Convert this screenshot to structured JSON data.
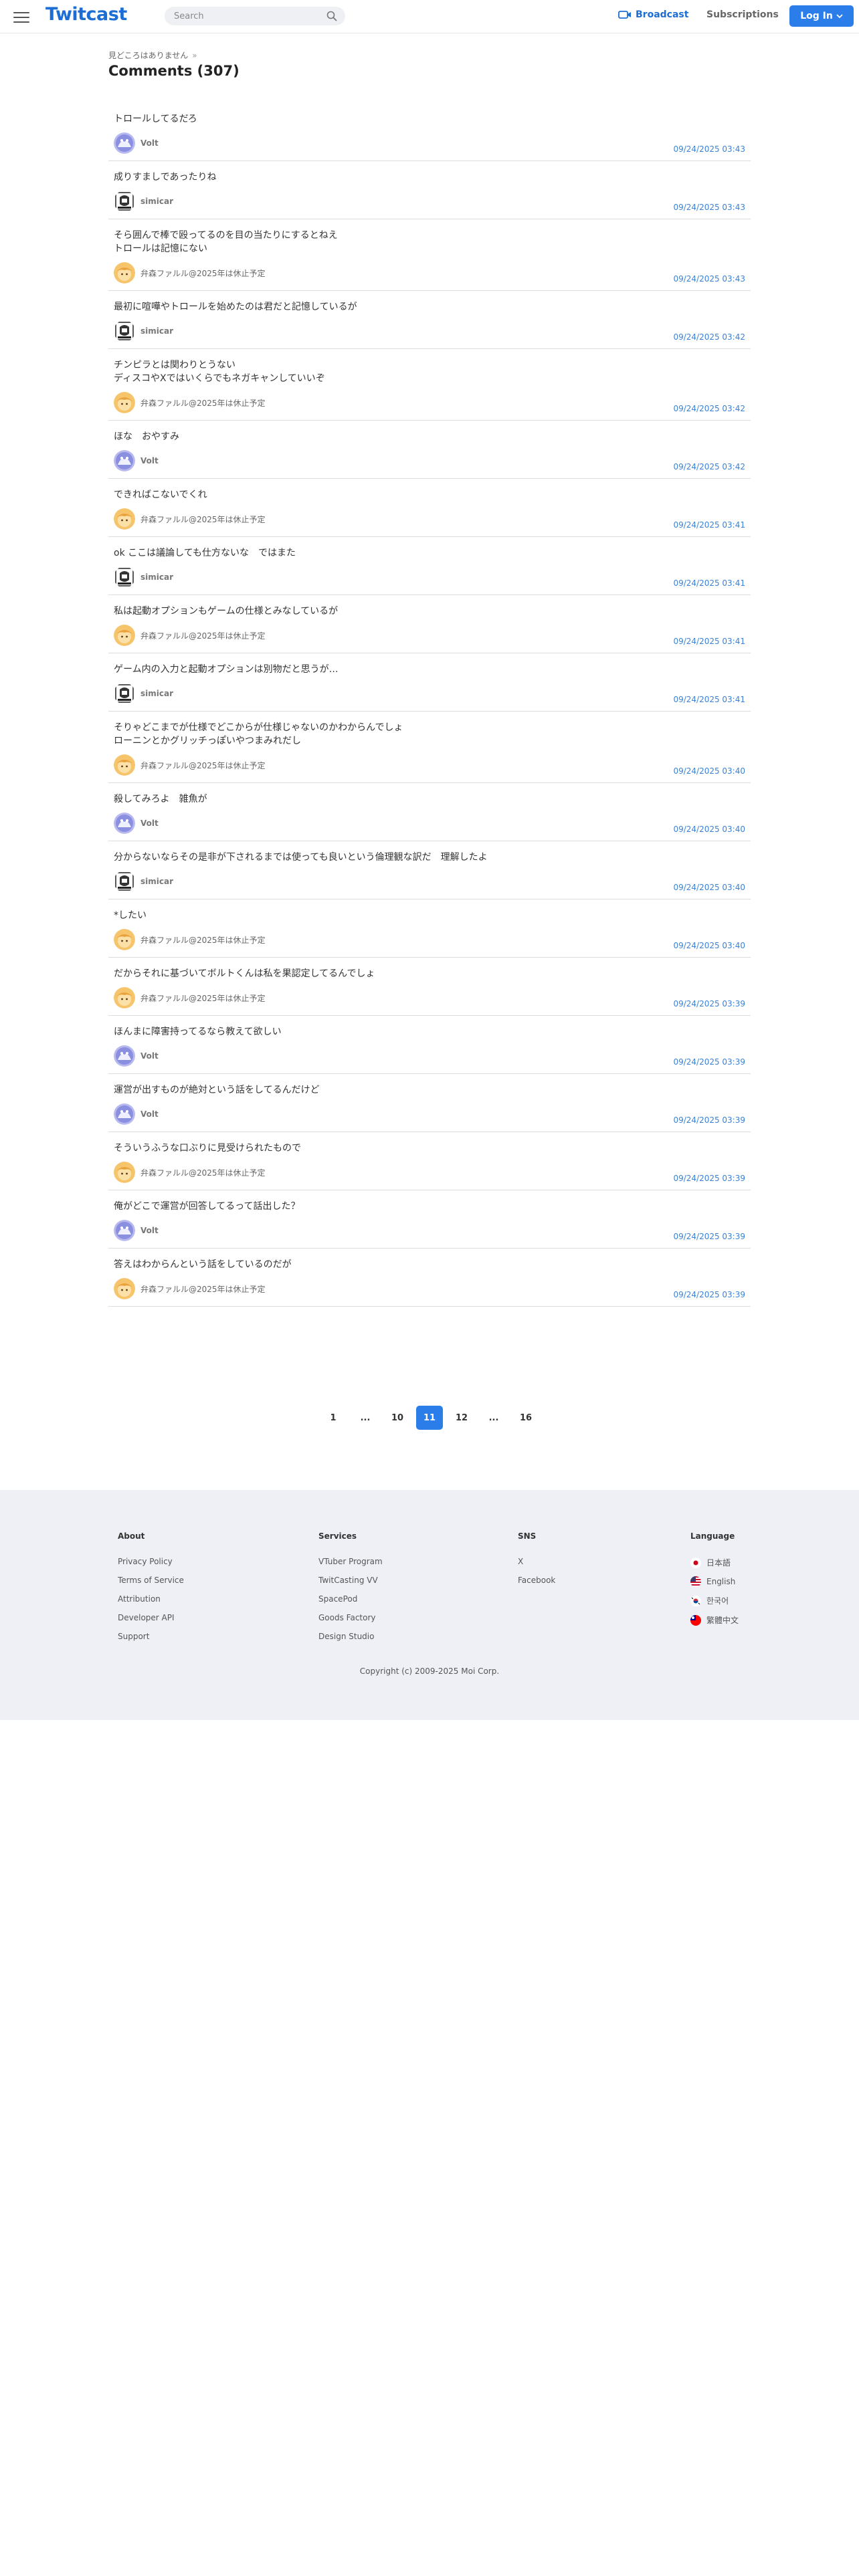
{
  "header": {
    "logo": "Twitcast",
    "search_placeholder": "Search",
    "broadcast_label": "Broadcast",
    "subscriptions_label": "Subscriptions",
    "login_label": "Log In",
    "accent_color": "#1c6ed4"
  },
  "page": {
    "breadcrumb": "見どころはありません",
    "breadcrumb_sep": "»",
    "title": "Comments (307)"
  },
  "comments": [
    {
      "text": "トロールしてるだろ",
      "user": "Volt",
      "avatar": "volt",
      "date": "09/24/2025 03:43"
    },
    {
      "text": "成りすましであったりね",
      "user": "simicar",
      "avatar": "simicar",
      "date": "09/24/2025 03:43"
    },
    {
      "text": "そら囲んで棒で殴ってるのを目の当たりにするとねえ\nトロールは記憶にない",
      "user": "弁森ファルル@2025年は休止予定",
      "avatar": "faruru",
      "date": "09/24/2025 03:43"
    },
    {
      "text": "最初に喧嘩やトロールを始めたのは君だと記憶しているが",
      "user": "simicar",
      "avatar": "simicar",
      "date": "09/24/2025 03:42"
    },
    {
      "text": "チンピラとは関わりとうない\nディスコやXではいくらでもネガキャンしていいぞ",
      "user": "弁森ファルル@2025年は休止予定",
      "avatar": "faruru",
      "date": "09/24/2025 03:42"
    },
    {
      "text": "ほな　おやすみ",
      "user": "Volt",
      "avatar": "volt",
      "date": "09/24/2025 03:42"
    },
    {
      "text": "できればこないでくれ",
      "user": "弁森ファルル@2025年は休止予定",
      "avatar": "faruru",
      "date": "09/24/2025 03:41"
    },
    {
      "text": "ok ここは議論しても仕方ないな　ではまた",
      "user": "simicar",
      "avatar": "simicar",
      "date": "09/24/2025 03:41"
    },
    {
      "text": "私は起動オプションもゲームの仕様とみなしているが",
      "user": "弁森ファルル@2025年は休止予定",
      "avatar": "faruru",
      "date": "09/24/2025 03:41"
    },
    {
      "text": "ゲーム内の入力と起動オプションは別物だと思うが…",
      "user": "simicar",
      "avatar": "simicar",
      "date": "09/24/2025 03:41"
    },
    {
      "text": "そりゃどこまでが仕様でどこからが仕様じゃないのかわからんでしょ\nローニンとかグリッチっぽいやつまみれだし",
      "user": "弁森ファルル@2025年は休止予定",
      "avatar": "faruru",
      "date": "09/24/2025 03:40"
    },
    {
      "text": "殺してみろよ　雑魚が",
      "user": "Volt",
      "avatar": "volt",
      "date": "09/24/2025 03:40"
    },
    {
      "text": "分からないならその是非が下されるまでは使っても良いという倫理観な訳だ　理解したよ",
      "user": "simicar",
      "avatar": "simicar",
      "date": "09/24/2025 03:40"
    },
    {
      "text": "*したい",
      "user": "弁森ファルル@2025年は休止予定",
      "avatar": "faruru",
      "date": "09/24/2025 03:40"
    },
    {
      "text": "だからそれに基づいてボルトくんは私を果認定してるんでしょ",
      "user": "弁森ファルル@2025年は休止予定",
      "avatar": "faruru",
      "date": "09/24/2025 03:39"
    },
    {
      "text": "ほんまに障害持ってるなら教えて欲しい",
      "user": "Volt",
      "avatar": "volt",
      "date": "09/24/2025 03:39"
    },
    {
      "text": "運営が出すものが絶対という話をしてるんだけど",
      "user": "Volt",
      "avatar": "volt",
      "date": "09/24/2025 03:39"
    },
    {
      "text": "そういうふうな口ぶりに見受けられたもので",
      "user": "弁森ファルル@2025年は休止予定",
      "avatar": "faruru",
      "date": "09/24/2025 03:39"
    },
    {
      "text": "俺がどこで運営が回答してるって話出した？",
      "user": "Volt",
      "avatar": "volt",
      "date": "09/24/2025 03:39"
    },
    {
      "text": "答えはわからんという話をしているのだが",
      "user": "弁森ファルル@2025年は休止予定",
      "avatar": "faruru",
      "date": "09/24/2025 03:39"
    }
  ],
  "pagination": [
    {
      "label": "1",
      "active": false
    },
    {
      "label": "...",
      "active": false,
      "dots": true
    },
    {
      "label": "10",
      "active": false
    },
    {
      "label": "11",
      "active": true
    },
    {
      "label": "12",
      "active": false
    },
    {
      "label": "...",
      "active": false,
      "dots": true
    },
    {
      "label": "16",
      "active": false
    }
  ],
  "footer": {
    "about": {
      "title": "About",
      "links": [
        "Privacy Policy",
        "Terms of Service",
        "Attribution",
        "Developer API",
        "Support"
      ]
    },
    "services": {
      "title": "Services",
      "links": [
        "VTuber Program",
        "TwitCasting VV",
        "SpacePod",
        "Goods Factory",
        "Design Studio"
      ]
    },
    "sns": {
      "title": "SNS",
      "links": [
        "X",
        "Facebook"
      ]
    },
    "language": {
      "title": "Language",
      "items": [
        {
          "label": "日本語",
          "flag": "japan-flag"
        },
        {
          "label": "English",
          "flag": "us-flag"
        },
        {
          "label": "한국어",
          "flag": "korea-flag"
        },
        {
          "label": "繁體中文",
          "flag": "taiwan-flag"
        }
      ]
    },
    "copyright": "Copyright (c) 2009-2025 Moi Corp."
  }
}
